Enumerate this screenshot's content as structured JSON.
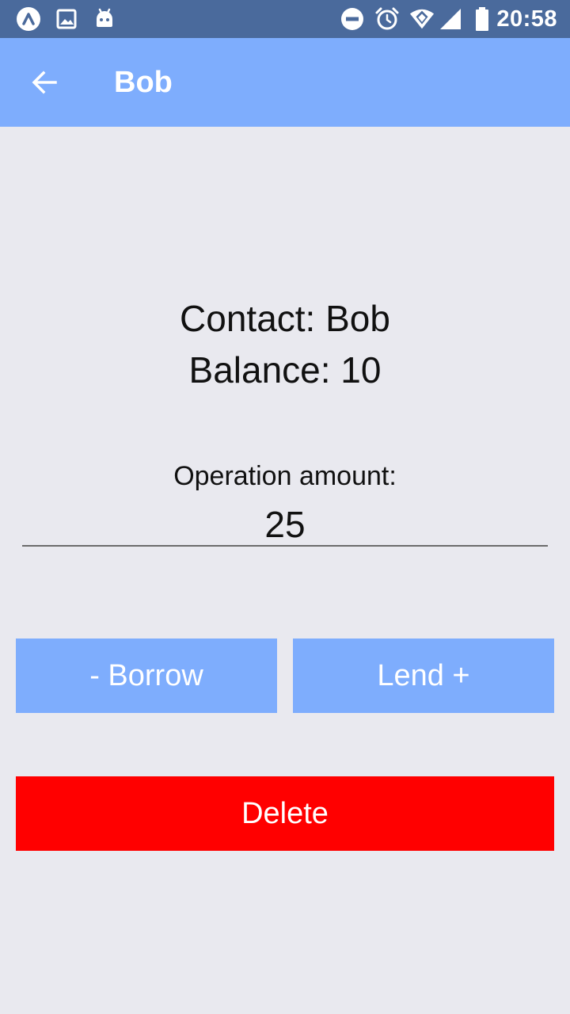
{
  "status_bar": {
    "time": "20:58",
    "icons": [
      "app-logo-icon",
      "image-icon",
      "android-icon",
      "do-not-disturb-icon",
      "alarm-icon",
      "wifi-icon",
      "signal-icon",
      "battery-icon"
    ]
  },
  "app_bar": {
    "title": "Bob",
    "back_icon": "arrow-back-icon"
  },
  "contact": {
    "name_line": "Contact: Bob",
    "balance_line": "Balance: 10"
  },
  "operation": {
    "label": "Operation amount:",
    "value": "25"
  },
  "buttons": {
    "borrow": "- Borrow",
    "lend": "Lend +",
    "delete": "Delete"
  },
  "colors": {
    "status_bar": "#4a6a9c",
    "app_bar": "#7eadfd",
    "primary_button": "#7eadfd",
    "delete_button": "#ff0000",
    "background": "#e9e9ef"
  }
}
